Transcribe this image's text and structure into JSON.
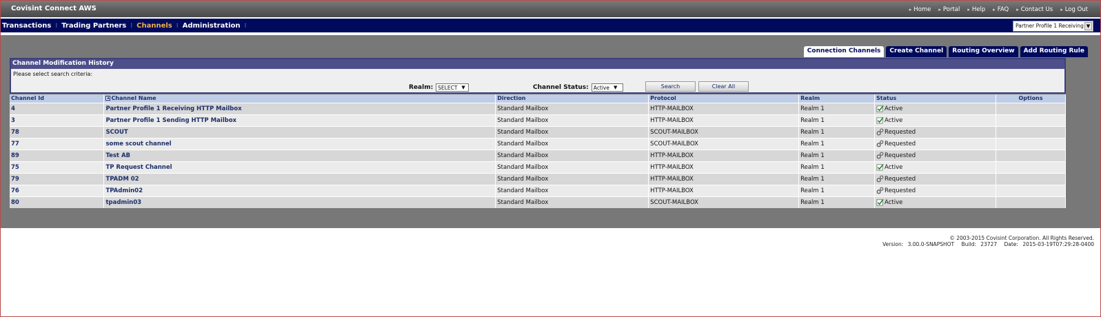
{
  "app": {
    "title": "Covisint Connect AWS"
  },
  "top_links": [
    "Home",
    "Portal",
    "Help",
    "FAQ",
    "Contact Us",
    "Log Out"
  ],
  "nav": {
    "items": [
      "Transactions",
      "Trading Partners",
      "Channels",
      "Administration"
    ],
    "active": "Channels"
  },
  "partner_profile": {
    "selected": "Partner Profile 1 Receiving"
  },
  "tabs": [
    "Connection Channels",
    "Create Channel",
    "Routing Overview",
    "Add Routing Rule"
  ],
  "active_tab": "Connection Channels",
  "panel": {
    "title": "Channel Modification History",
    "hint": "Please select search criteria:",
    "realm_label": "Realm:",
    "realm_value": "SELECT",
    "status_label": "Channel Status:",
    "status_value": "Active",
    "search_label": "Search",
    "clear_label": "Clear All"
  },
  "table": {
    "headers": [
      "Channel Id",
      "Channel Name",
      "Direction",
      "Protocol",
      "Realm",
      "Status",
      "Options"
    ],
    "rows": [
      {
        "id": "4",
        "name": "Partner Profile 1 Receiving HTTP Mailbox",
        "direction": "Standard Mailbox",
        "protocol": "HTTP-MAILBOX",
        "realm": "Realm 1",
        "status": "Active",
        "icon": "check-icon"
      },
      {
        "id": "3",
        "name": "Partner Profile 1 Sending HTTP Mailbox",
        "direction": "Standard Mailbox",
        "protocol": "HTTP-MAILBOX",
        "realm": "Realm 1",
        "status": "Active",
        "icon": "check-icon"
      },
      {
        "id": "78",
        "name": "SCOUT",
        "direction": "Standard Mailbox",
        "protocol": "SCOUT-MAILBOX",
        "realm": "Realm 1",
        "status": "Requested",
        "icon": "gears-icon"
      },
      {
        "id": "77",
        "name": "some scout channel",
        "direction": "Standard Mailbox",
        "protocol": "SCOUT-MAILBOX",
        "realm": "Realm 1",
        "status": "Requested",
        "icon": "gears-icon"
      },
      {
        "id": "89",
        "name": "Test AB",
        "direction": "Standard Mailbox",
        "protocol": "HTTP-MAILBOX",
        "realm": "Realm 1",
        "status": "Requested",
        "icon": "gears-icon"
      },
      {
        "id": "75",
        "name": "TP Request Channel",
        "direction": "Standard Mailbox",
        "protocol": "HTTP-MAILBOX",
        "realm": "Realm 1",
        "status": "Active",
        "icon": "check-icon"
      },
      {
        "id": "79",
        "name": "TPADM 02",
        "direction": "Standard Mailbox",
        "protocol": "HTTP-MAILBOX",
        "realm": "Realm 1",
        "status": "Requested",
        "icon": "gears-icon"
      },
      {
        "id": "76",
        "name": "TPAdmin02",
        "direction": "Standard Mailbox",
        "protocol": "HTTP-MAILBOX",
        "realm": "Realm 1",
        "status": "Requested",
        "icon": "gears-icon"
      },
      {
        "id": "80",
        "name": "tpadmin03",
        "direction": "Standard Mailbox",
        "protocol": "SCOUT-MAILBOX",
        "realm": "Realm 1",
        "status": "Active",
        "icon": "check-icon"
      }
    ]
  },
  "footer": {
    "copyright": "© 2003-2015 Covisint Corporation. All Rights Reserved.",
    "version_label": "Version:",
    "version": "3.00.0-SNAPSHOT",
    "build_label": "Build:",
    "build": "23727",
    "date_label": "Date:",
    "date": "2015-03-19T07:29:28-0400"
  },
  "colors": {
    "nav_bg": "#000a5c",
    "active_nav": "#f4b14a",
    "panel_title_bg": "#4d4f8b",
    "header_bg": "#bfcde6",
    "content_bg": "#787878"
  }
}
